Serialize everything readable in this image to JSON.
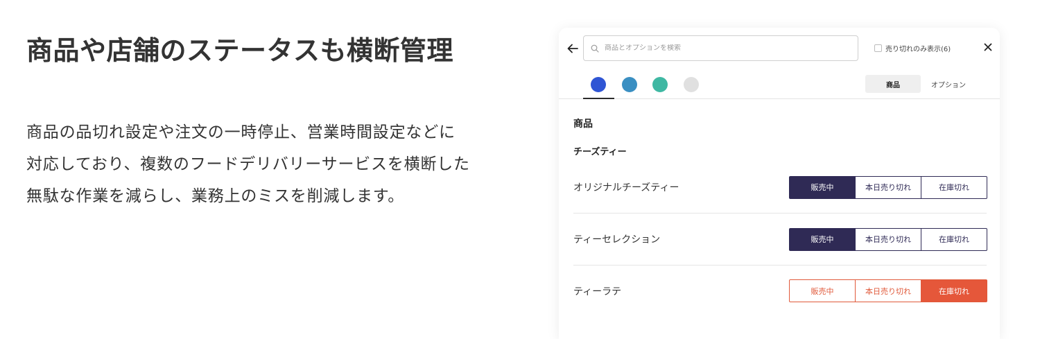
{
  "hero": {
    "title": "商品や店舗のステータスも横断管理",
    "description": "商品の品切れ設定や注文の一時停止、営業時間設定などに対応しており、複数のフードデリバリーサービスを横断した無駄な作業を減らし、業務上のミスを削減します。"
  },
  "panel": {
    "back_icon": "arrow-left-icon",
    "search": {
      "placeholder": "商品とオプションを検索",
      "value": ""
    },
    "soldout_filter_label": "売り切れのみ表示(6)",
    "close_icon": "close-icon",
    "service_tabs": [
      {
        "name": "service-tab-1",
        "color": "#2f55d4",
        "selected": true
      },
      {
        "name": "service-tab-2",
        "color": "#3a8fc2",
        "selected": false
      },
      {
        "name": "service-tab-3",
        "color": "#3fb8a3",
        "selected": false
      },
      {
        "name": "service-tab-4",
        "color": "#e0e0e0",
        "selected": false
      }
    ],
    "view_toggle": {
      "products": "商品",
      "options": "オプション"
    },
    "section_title": "商品",
    "subsection_title": "チーズティー",
    "status_labels": {
      "on_sale": "販売中",
      "sold_out_today": "本日売り切れ",
      "out_of_stock": "在庫切れ"
    },
    "items": [
      {
        "name": "オリジナルチーズティー",
        "status": "on_sale"
      },
      {
        "name": "ティーセレクション",
        "status": "on_sale"
      },
      {
        "name": "ティーラテ",
        "status": "out_of_stock"
      }
    ]
  },
  "colors": {
    "navy": "#2f2a55",
    "orange": "#e5573a"
  }
}
